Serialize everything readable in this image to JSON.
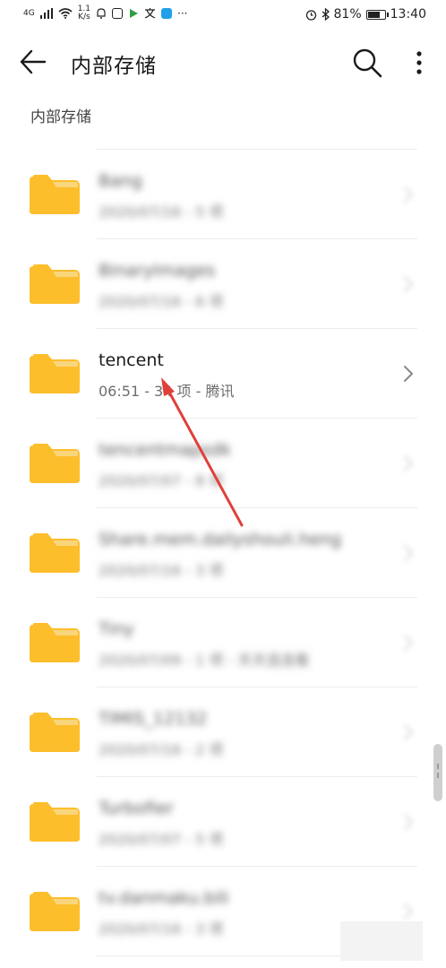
{
  "status_bar": {
    "network": "4G",
    "speed_value": "1.1",
    "speed_unit": "K/s",
    "more": "···",
    "battery": "81%",
    "battery_level": 0.81,
    "time": "13:40"
  },
  "header": {
    "title": "内部存储",
    "back_icon": "arrow-left-icon",
    "search_icon": "search-icon",
    "more_icon": "vertical-dots-icon"
  },
  "breadcrumb": "内部存储",
  "colors": {
    "folder": "#FDBE2C",
    "folder_tab": "#F9D57C",
    "annotation_arrow": "#E0403A"
  },
  "rows": [
    {
      "name": "Bang",
      "meta": "2020/07/16 - 5 项",
      "blurred": true
    },
    {
      "name": "BinaryImages",
      "meta": "2020/07/16 - 6 项",
      "blurred": true
    },
    {
      "name": "tencent",
      "meta": "06:51 - 34 项 - 腾讯",
      "blurred": false
    },
    {
      "name": "tencentmapsdk",
      "meta": "2020/07/07 - 8 项",
      "blurred": true
    },
    {
      "name": "Share.mem.dailyshouli.heng",
      "meta": "2020/07/16 - 3 项",
      "blurred": true
    },
    {
      "name": "Tiny",
      "meta": "2020/07/09 - 1 项 - 天天连连看",
      "blurred": true
    },
    {
      "name": "TIMIS_12132",
      "meta": "2020/07/16 - 2 项",
      "blurred": true
    },
    {
      "name": "Turbofier",
      "meta": "2020/07/07 - 5 项",
      "blurred": true
    },
    {
      "name": "tv.danmaku.bili",
      "meta": "2020/07/16 - 3 项",
      "blurred": true
    }
  ]
}
